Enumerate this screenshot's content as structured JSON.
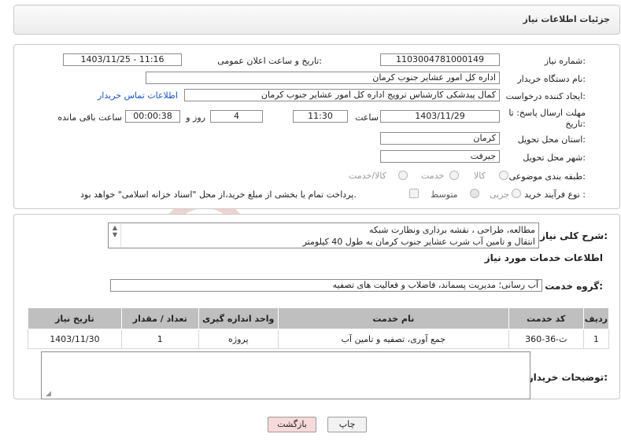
{
  "page": {
    "title": "جزئیات اطلاعات نیاز"
  },
  "details": {
    "need_number_label": "شماره نیاز:",
    "need_number": "1103004781000149",
    "announce_label": "تاریخ و ساعت اعلان عمومی:",
    "announce_value": "1403/11/25 - 11:16",
    "buyer_org_label": "نام دستگاه خریدار:",
    "buyer_org": "اداره کل امور عشایر جنوب کرمان",
    "requester_label": "ایجاد کننده درخواست:",
    "requester": "کمال پیدشکی کارشناس ترویج اداره کل امور عشایر جنوب کرمان",
    "contact_link": "اطلاعات تماس خریدار",
    "deadline_label_1": "مهلت ارسال پاسخ: تا",
    "deadline_label_2": "تاریخ:",
    "deadline_date": "1403/11/29",
    "time_label": "ساعت",
    "deadline_time": "11:30",
    "days_value": "4",
    "days_label": "روز و",
    "remaining_time": "00:00:38",
    "remaining_label": "ساعت باقی مانده",
    "province_label": "استان محل تحویل:",
    "province": "کرمان",
    "city_label": "شهر محل تحویل:",
    "city": "جیرفت",
    "category_label": "طبقه بندی موضوعی:",
    "category_options": [
      "کالا",
      "خدمت",
      "کالا/خدمت"
    ],
    "process_label": "نوع فرآیند خرید :",
    "process_options": [
      "جزیی",
      "متوسط"
    ],
    "payment_note": "پرداخت تمام یا بخشی از مبلغ خرید،از محل \"اسناد خزانه اسلامی\" خواهد بود."
  },
  "summary": {
    "label": "شرح کلی نیاز:",
    "line1": "مطالعه، طراحی ، نقشه برداری ونظارت شبکه",
    "line2": "انتقال و تامین آب شرب عشایر جنوب کرمان به طول 40 کیلومتر"
  },
  "services": {
    "section_title": "اطلاعات خدمات مورد نیاز",
    "group_label": "گروه خدمت:",
    "group_value": "آب رسانی؛ مدیریت پسماند، فاضلاب و فعالیت های تصفیه",
    "columns": [
      "ردیف",
      "کد خدمت",
      "نام خدمت",
      "واحد اندازه گیری",
      "تعداد / مقدار",
      "تاریخ نیاز"
    ],
    "rows": [
      {
        "row": "1",
        "code": "ث-36-360",
        "name": "جمع آوری، تصفیه و تامین آب",
        "unit": "پروژه",
        "qty": "1",
        "date": "1403/11/30"
      }
    ]
  },
  "notes": {
    "label": "توضیحات خریدار:",
    "value": ""
  },
  "buttons": {
    "print": "چاپ",
    "back": "بازگشت"
  },
  "watermark": {
    "text": "AriaTender.neT"
  },
  "colors": {
    "link": "#1b55c8",
    "back_button_bg": "#f7d9d9",
    "table_header": "#bfbfbf",
    "watermark": "#e9c6c6"
  }
}
